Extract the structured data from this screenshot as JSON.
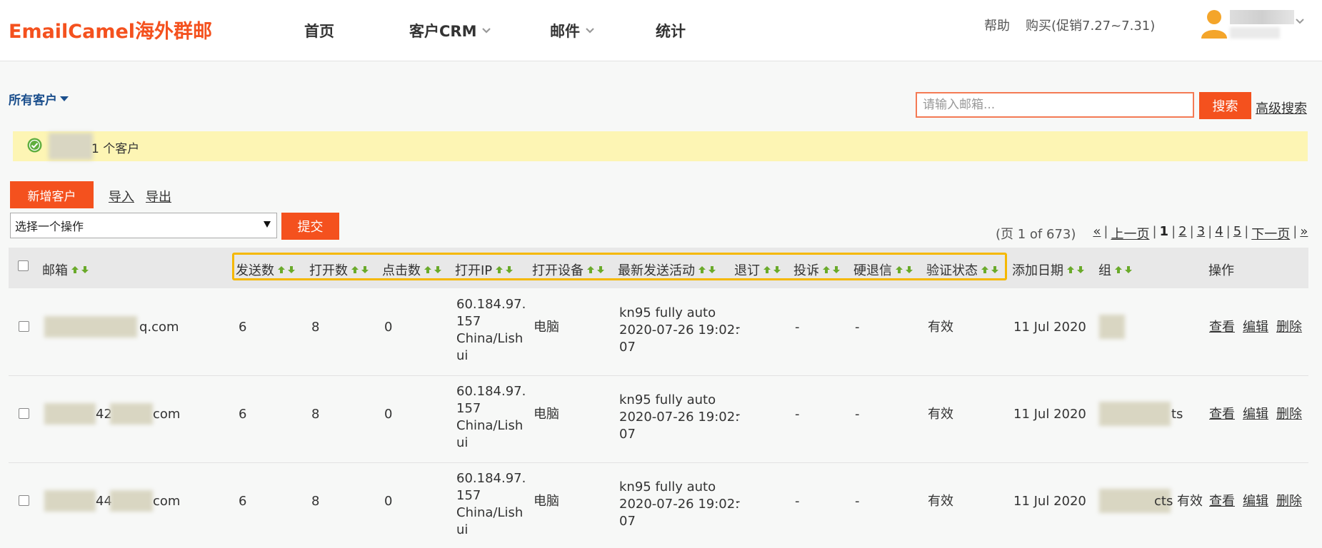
{
  "header": {
    "logo": "EmailCamel海外群邮",
    "nav": [
      {
        "label": "首页",
        "has_dropdown": false
      },
      {
        "label": "客户CRM",
        "has_dropdown": true
      },
      {
        "label": "邮件",
        "has_dropdown": true
      },
      {
        "label": "统计",
        "has_dropdown": false
      }
    ],
    "help": "帮助",
    "buy": "购买(促销7.27~7.31)"
  },
  "filter": {
    "all_customers": "所有客户",
    "search_placeholder": "请输入邮箱...",
    "search_button": "搜索",
    "advanced_search": "高级搜索"
  },
  "notice": {
    "text": "1 个客户"
  },
  "actions": {
    "add_customer": "新增客户",
    "import": "导入",
    "export": "导出",
    "select_operation": "选择一个操作",
    "submit": "提交"
  },
  "pagination": {
    "summary": "(页 1 of 673)",
    "first": "«",
    "prev": "上一页",
    "pages": [
      "1",
      "2",
      "3",
      "4",
      "5"
    ],
    "current": "1",
    "next": "下一页",
    "last": "»"
  },
  "table": {
    "columns": [
      "邮箱",
      "发送数",
      "打开数",
      "点击数",
      "打开IP",
      "打开设备",
      "最新发送活动",
      "退订",
      "投诉",
      "硬退信",
      "验证状态",
      "添加日期",
      "组",
      "操作"
    ],
    "rows": [
      {
        "email_suffix": "q.com",
        "sent": "6",
        "opens": "8",
        "clicks": "0",
        "ip": [
          "60.184.97.",
          "157",
          "China/Lish",
          "ui"
        ],
        "device": "电脑",
        "activity": [
          "kn95 fully auto",
          "2020-07-26 19:02:",
          "07"
        ],
        "unsub": "-",
        "complaint": "-",
        "bounce": "-",
        "verify": "有效",
        "date": "11 Jul 2020",
        "group": "",
        "view": "查看",
        "edit": "编辑",
        "delete": "删除"
      },
      {
        "email_suffix": "com",
        "email_prefix": "42",
        "sent": "6",
        "opens": "8",
        "clicks": "0",
        "ip": [
          "60.184.97.",
          "157",
          "China/Lish",
          "ui"
        ],
        "device": "电脑",
        "activity": [
          "kn95 fully auto",
          "2020-07-26 19:02:",
          "07"
        ],
        "unsub": "-",
        "complaint": "-",
        "bounce": "-",
        "verify": "有效",
        "date": "11 Jul 2020",
        "group": "ts",
        "view": "查看",
        "edit": "编辑",
        "delete": "删除"
      },
      {
        "email_suffix": "com",
        "email_prefix": "44",
        "sent": "6",
        "opens": "8",
        "clicks": "0",
        "ip": [
          "60.184.97.",
          "157",
          "China/Lish",
          "ui"
        ],
        "device": "电脑",
        "activity": [
          "kn95 fully auto",
          "2020-07-26 19:02:",
          "07"
        ],
        "unsub": "-",
        "complaint": "-",
        "bounce": "-",
        "verify": "有效",
        "date": "11 Jul 2020",
        "group": "cts 有效",
        "view": "查看",
        "edit": "编辑",
        "delete": "删除"
      }
    ]
  },
  "colors": {
    "brand": "#f4511e",
    "link": "#1a4e8c",
    "notice_bg": "#fdf5b4",
    "highlight": "#f5b800",
    "sort_arrow": "#6aaa2a"
  }
}
